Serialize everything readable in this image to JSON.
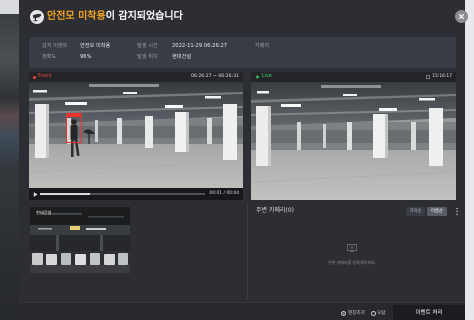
{
  "colors": {
    "accent": "#f5a623",
    "event": "#e8453c",
    "live": "#3fcf6a",
    "modal": "#2c2e33",
    "panel": "#393c43"
  },
  "icons": {
    "header": "cctv-icon",
    "close": "close-icon",
    "event": "record-dot-icon",
    "live": "play-icon",
    "player": "play-icon",
    "live_square": "square-icon",
    "more": "more-vertical-icon",
    "empty": "no-camera-icon"
  },
  "header": {
    "title_highlight": "안전모 미착용",
    "title_rest": "이 감지되었습니다"
  },
  "info": {
    "event_label": "감지 이벤트",
    "event_value": "안전모 미착용",
    "time_label": "발생 시간",
    "time_value": "2022-11-29 06:26:27",
    "camera_label": "카메라",
    "accuracy_label": "정확도",
    "accuracy_value": "96%",
    "location_label": "발생 위치",
    "location_value": "현대건설"
  },
  "event_video": {
    "badge": "Event",
    "range": "06:26:27 ~ 06:26:31",
    "time": "00:01 / 00:04",
    "progress": 0.3
  },
  "live_video": {
    "badge": "Live",
    "clock": "15:16:17"
  },
  "thumbnail": {
    "label": "현대건설"
  },
  "nearby": {
    "title": "주변 카메라(0)",
    "sort_options": [
      "거리순",
      "이름순"
    ],
    "selected_sort": 1,
    "empty_text": "주변 카메라를 등록해주세요."
  },
  "footer": {
    "options": [
      "현장조치",
      "오탐"
    ],
    "selected_option": 0,
    "submit_label": "이벤트 처리"
  }
}
